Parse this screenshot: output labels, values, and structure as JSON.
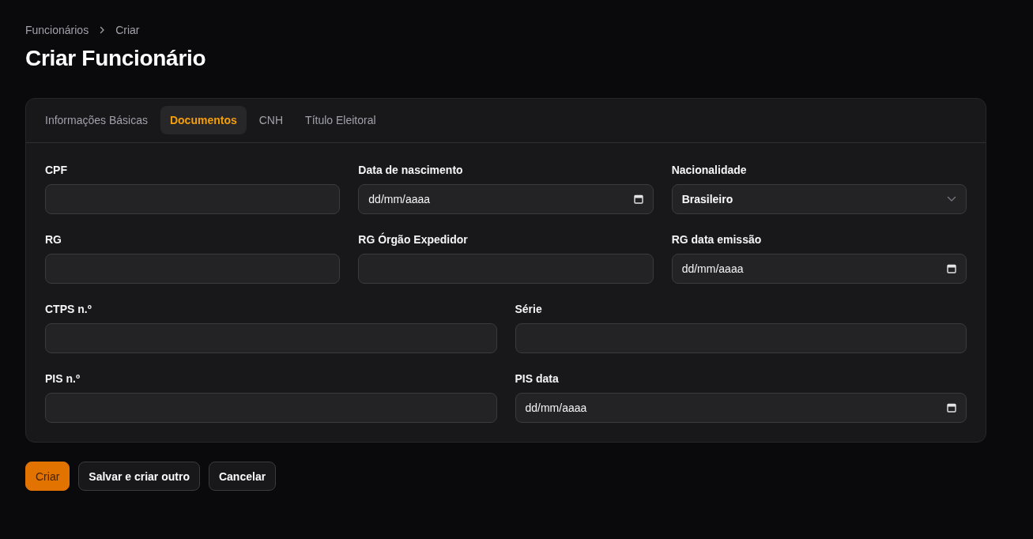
{
  "breadcrumb": [
    {
      "label": "Funcionários"
    },
    {
      "label": "Criar"
    }
  ],
  "title": "Criar Funcionário",
  "tabs": [
    {
      "label": "Informações Básicas",
      "selected": false
    },
    {
      "label": "Documentos",
      "selected": true
    },
    {
      "label": "CNH",
      "selected": false
    },
    {
      "label": "Título Eleitoral",
      "selected": false
    }
  ],
  "form": {
    "rows": [
      {
        "fields": [
          {
            "kind": "text",
            "label": "CPF"
          },
          {
            "kind": "date",
            "label": "Data de nascimento",
            "placeholder": "dd/mm/aaaa"
          },
          {
            "kind": "select",
            "label": "Nacionalidade",
            "value": "Brasileiro"
          }
        ]
      },
      {
        "fields": [
          {
            "kind": "text",
            "label": "RG"
          },
          {
            "kind": "text",
            "label": "RG Órgão Expedidor"
          },
          {
            "kind": "date",
            "label": "RG data emissão",
            "placeholder": "dd/mm/aaaa"
          }
        ]
      },
      {
        "fields": [
          {
            "kind": "text",
            "label": "CTPS n.º"
          },
          {
            "kind": "text",
            "label": "Série"
          }
        ]
      },
      {
        "fields": [
          {
            "kind": "text",
            "label": "PIS n.º"
          },
          {
            "kind": "date",
            "label": "PIS data",
            "placeholder": "dd/mm/aaaa"
          }
        ]
      }
    ]
  },
  "buttons": [
    {
      "label": "Criar",
      "kind": "primary"
    },
    {
      "label": "Salvar e criar outro",
      "kind": "secondary"
    },
    {
      "label": "Cancelar",
      "kind": "secondary"
    }
  ]
}
